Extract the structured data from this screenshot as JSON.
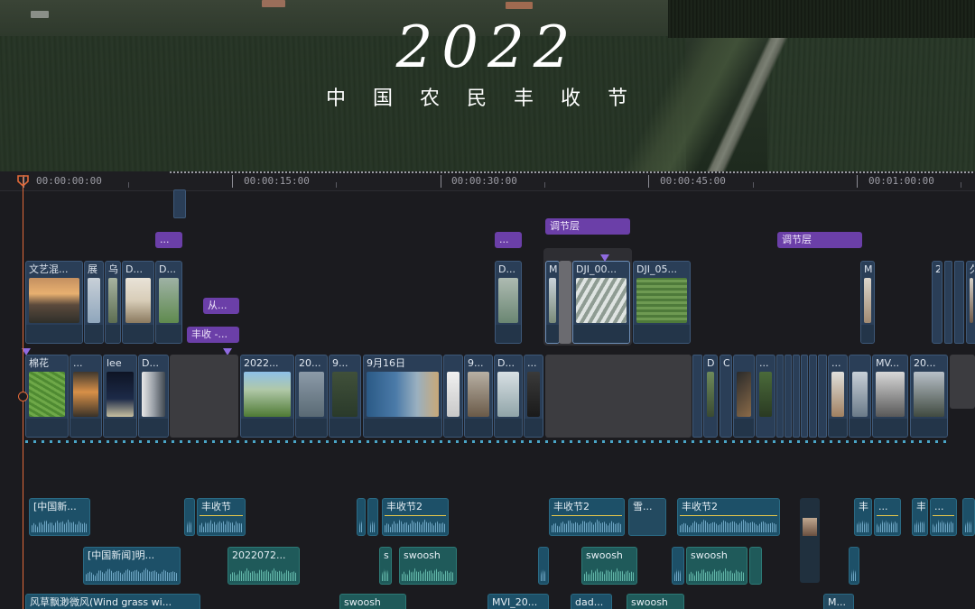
{
  "preview": {
    "title_year": "2022",
    "title_subtitle": "中国农民丰收节"
  },
  "ruler": {
    "timecodes": [
      "00:00:00:00",
      "00:00:15:00",
      "00:00:30:00",
      "00:00:45:00",
      "00:01:00:00"
    ]
  },
  "adjustment_layers": {
    "a1": "...",
    "a2": "...",
    "a3": "调节层",
    "a4": "调节层"
  },
  "overlay_clips": {
    "c1": "文艺混...",
    "c2": "展",
    "c3": "乌",
    "c4": "D...",
    "c5": "D...",
    "c6": "D...",
    "c7": "M",
    "c8": "DJI_00...",
    "c9": "DJI_05...",
    "c10": "M",
    "c11": "2",
    "c12": "久"
  },
  "title_clips": {
    "t1": "从...",
    "t2": "丰收 -..."
  },
  "main_clips": {
    "m1": "棉花",
    "m2": "...",
    "m3": "lee",
    "m4": "D...",
    "m5": "2022...",
    "m6": "20...",
    "m7": "9...",
    "m8": "9月16日",
    "m9": "9...",
    "m10": "D...",
    "m11": "...",
    "m12": "D",
    "m13": "C",
    "m14": "...",
    "m15": "MV...",
    "m16": "20..."
  },
  "audio_track1": {
    "a1": "[中国新...",
    "a2": "丰收节",
    "a3": "丰收节2",
    "a4": "丰收节2",
    "a5": "雪...",
    "a6": "丰收节2",
    "a7": "丰",
    "a8": "...",
    "a9": "丰",
    "a10": "..."
  },
  "audio_track2": {
    "b1": "[中国新闻]明...",
    "b2": "2022072...",
    "b3": "s",
    "b4": "swoosh",
    "b5": "swoosh",
    "b6": "swoosh"
  },
  "audio_track3": {
    "c1": "风草飘渺微风(Wind grass wi...",
    "c2": "swoosh",
    "c3": "MVI_20...",
    "c4": "dad...",
    "c5": "swoosh",
    "c6": "M..."
  },
  "colors": {
    "video_clip": "#2a3e57",
    "adjustment_layer": "#6b3fa8",
    "audio_clip": "#1d5068",
    "playhead": "#e26a3a"
  }
}
